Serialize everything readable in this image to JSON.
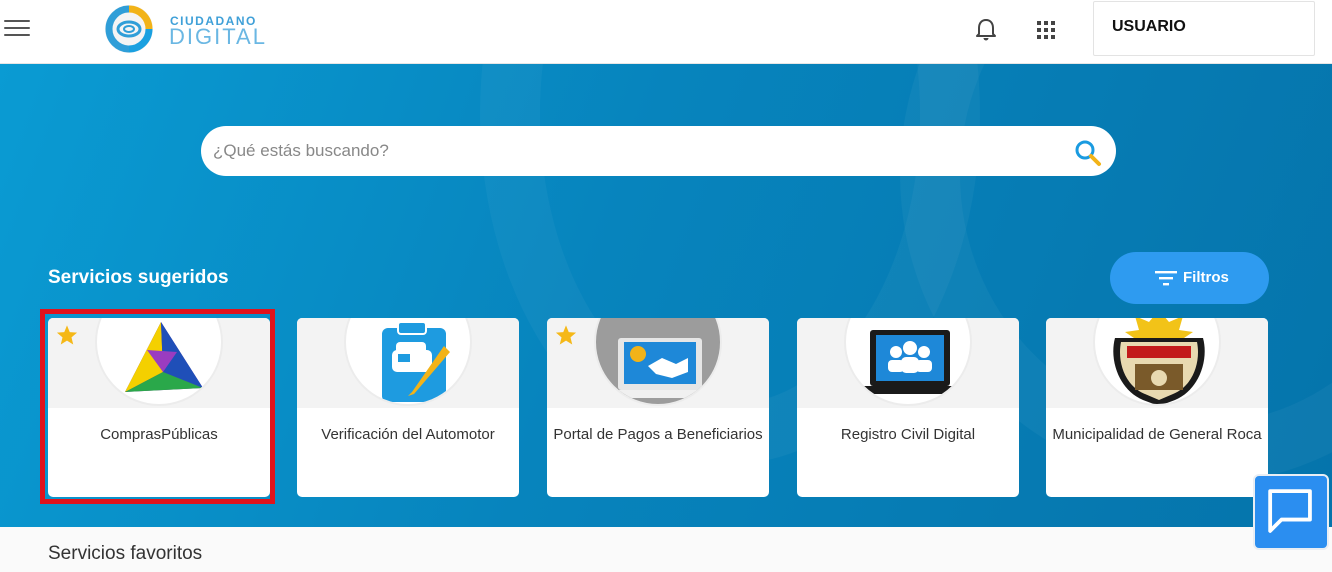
{
  "header": {
    "logo_line1": "CIUDADANO",
    "logo_line2": "DIGITAL",
    "user_label": "USUARIO"
  },
  "search": {
    "placeholder": "¿Qué estás buscando?",
    "value": ""
  },
  "suggested": {
    "title": "Servicios sugeridos",
    "filter_label": "Filtros",
    "cards": [
      {
        "label": "ComprasPúblicas",
        "favorite": true,
        "icon": "triangle-logo-icon"
      },
      {
        "label": "Verificación del Automotor",
        "favorite": false,
        "icon": "car-checklist-icon"
      },
      {
        "label": "Portal de Pagos a Beneficiarios",
        "favorite": true,
        "icon": "laptop-payment-icon"
      },
      {
        "label": "Registro Civil Digital",
        "favorite": false,
        "icon": "laptop-people-icon"
      },
      {
        "label": "Municipalidad de General Roca",
        "favorite": false,
        "icon": "coat-of-arms-icon"
      }
    ]
  },
  "favorites": {
    "title": "Servicios favoritos"
  },
  "colors": {
    "hero_blue": "#0784bd",
    "accent": "#2e9bf0",
    "highlight": "#e0131c",
    "star": "#f5b817"
  }
}
